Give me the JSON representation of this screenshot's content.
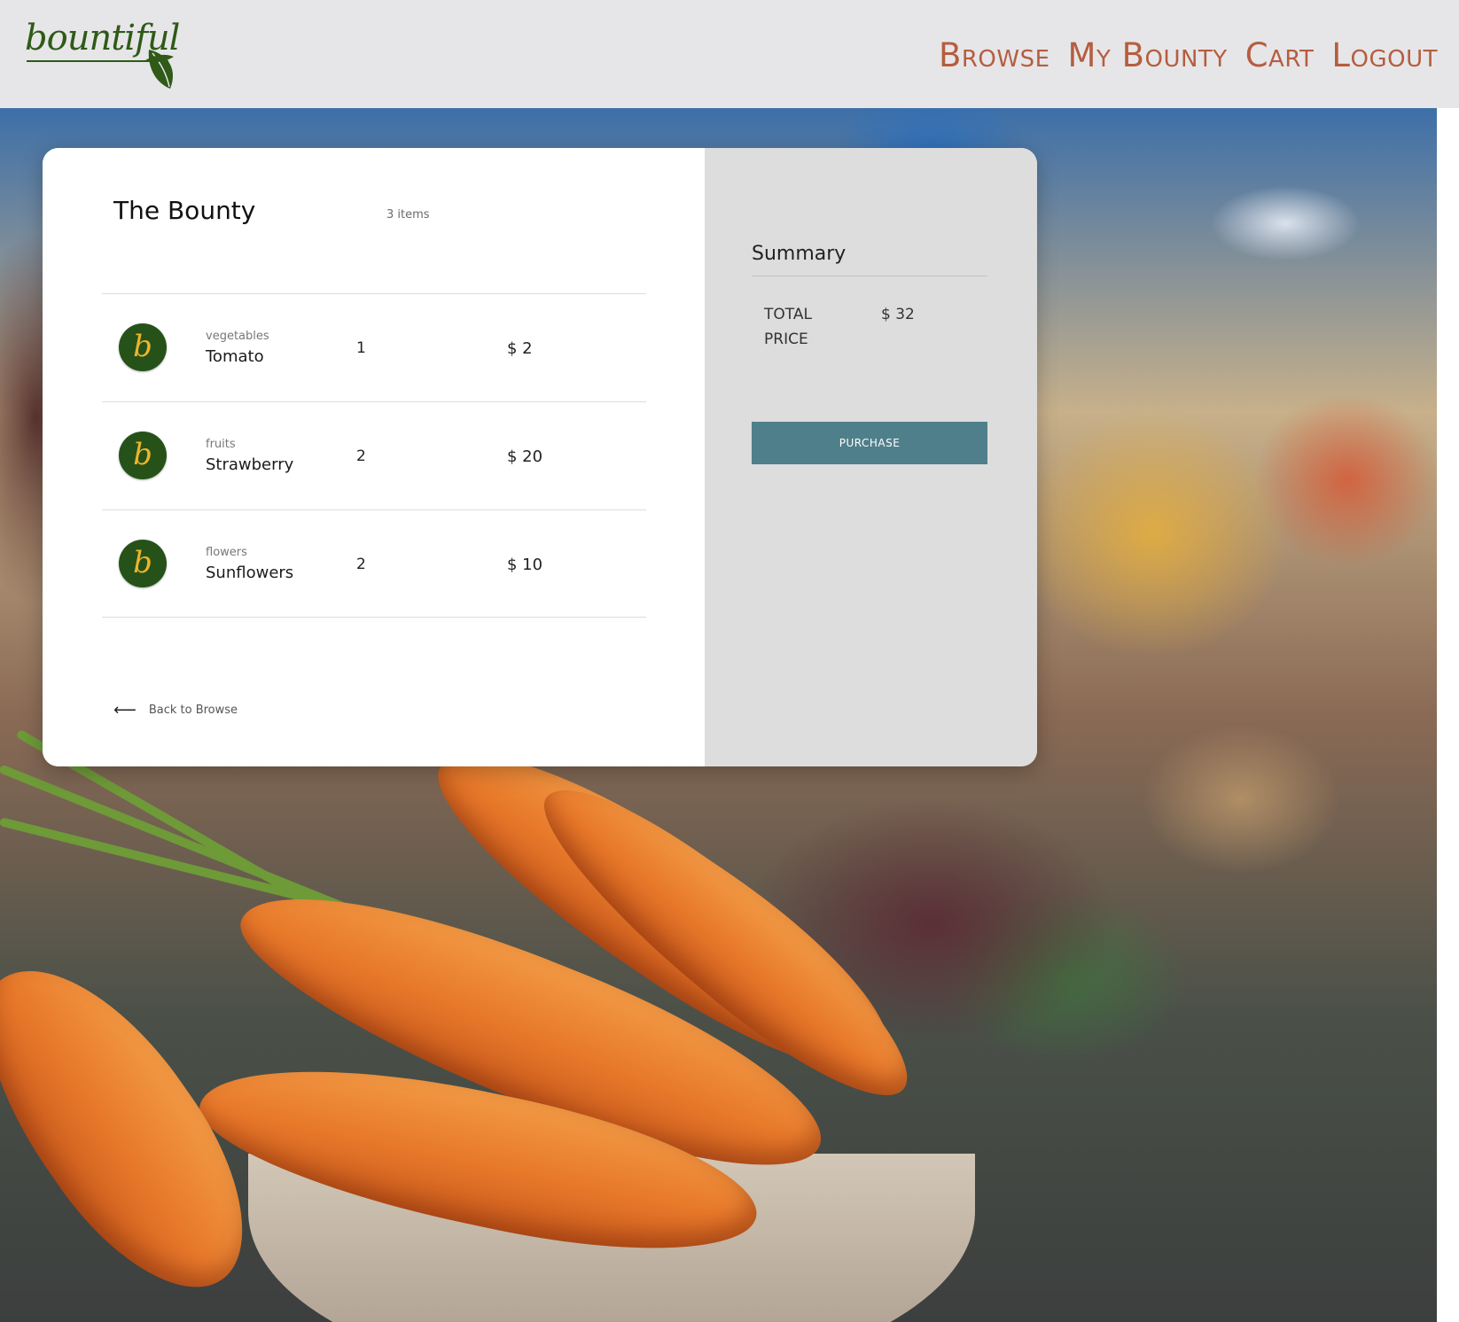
{
  "brand": {
    "name": "bountiful"
  },
  "nav": {
    "items": [
      {
        "label": "Browse"
      },
      {
        "label": "My Bounty"
      },
      {
        "label": "Cart"
      },
      {
        "label": "Logout"
      }
    ]
  },
  "cart": {
    "title": "The Bounty",
    "item_count": "3 items",
    "items": [
      {
        "category": "vegetables",
        "name": "Tomato",
        "quantity": "1",
        "price": "$ 2",
        "thumb_glyph": "b"
      },
      {
        "category": "fruits",
        "name": "Strawberry",
        "quantity": "2",
        "price": "$ 20",
        "thumb_glyph": "b"
      },
      {
        "category": "flowers",
        "name": "Sunflowers",
        "quantity": "2",
        "price": "$ 10",
        "thumb_glyph": "b"
      }
    ],
    "back_link": "Back to Browse",
    "back_icon": "arrow-left-icon"
  },
  "summary": {
    "title": "Summary",
    "total_label": "TOTAL PRICE",
    "total_value": "$ 32",
    "purchase_label": "PURCHASE"
  },
  "colors": {
    "header_bg": "#e6e6e8",
    "nav_text": "#b65d40",
    "brand_green": "#2f5a17",
    "thumb_bg": "#26521a",
    "thumb_glyph": "#f0b429",
    "summary_bg": "#dddddd",
    "purchase_button": "#4f7f8b"
  }
}
